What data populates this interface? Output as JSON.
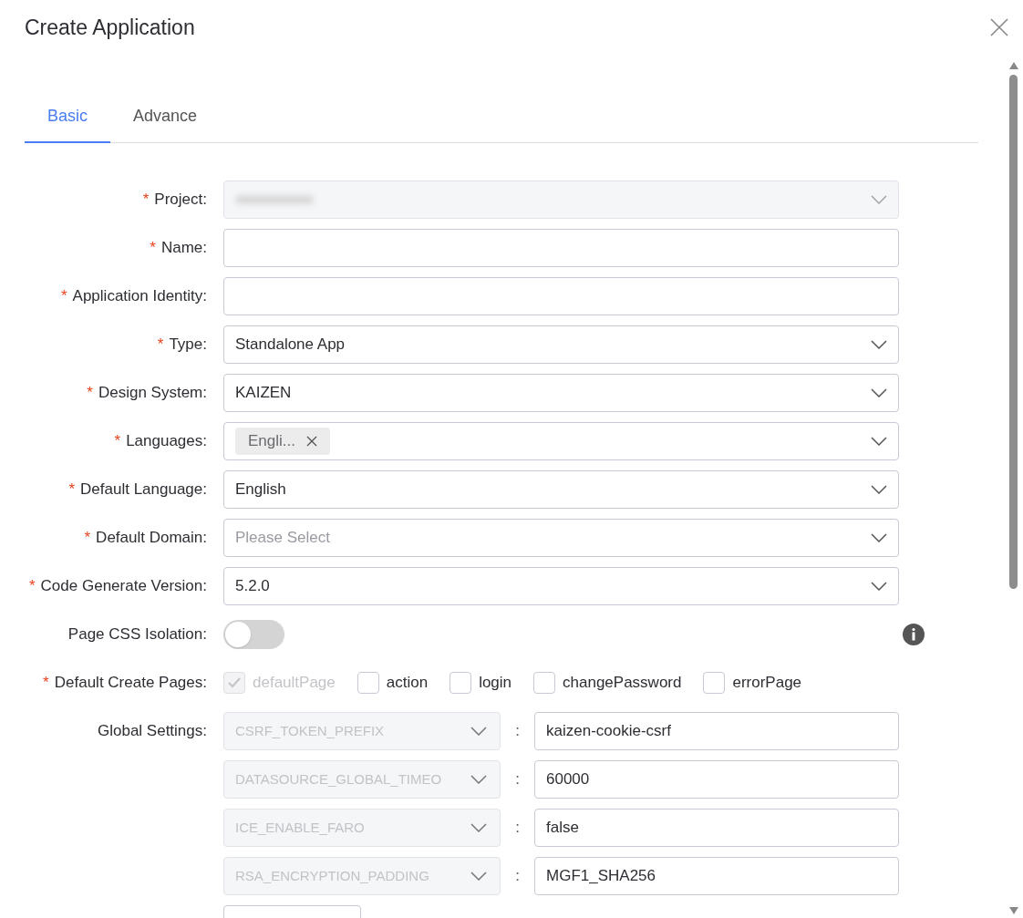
{
  "dialog": {
    "title": "Create Application"
  },
  "tabs": [
    {
      "label": "Basic",
      "selected": true
    },
    {
      "label": "Advance",
      "selected": false
    }
  ],
  "fields": [
    {
      "kind": "select",
      "label": "Project:",
      "required_mark": "*",
      "disabled": true,
      "value_blurred": true
    },
    {
      "kind": "input",
      "label": "Name:",
      "required_mark": "*"
    },
    {
      "kind": "input",
      "label": "Application Identity:",
      "required_mark": "*"
    },
    {
      "kind": "select",
      "label": "Type:",
      "required_mark": "*",
      "disabled": false,
      "value": "Standalone App"
    },
    {
      "kind": "select",
      "label": "Design System:",
      "required_mark": "*",
      "disabled": false,
      "value": "KAIZEN"
    },
    {
      "kind": "tags",
      "label": "Languages:",
      "required_mark": "*",
      "tags": [
        "Engli..."
      ]
    },
    {
      "kind": "select",
      "label": "Default Language:",
      "required_mark": "*",
      "disabled": false,
      "value": "English"
    },
    {
      "kind": "select",
      "label": "Default Domain:",
      "required_mark": "*",
      "disabled": false,
      "placeholder": "Please Select"
    },
    {
      "kind": "select",
      "label": "Code Generate Version:",
      "required_mark": "*",
      "disabled": false,
      "value": "5.2.0"
    },
    {
      "kind": "switch",
      "label": "Page CSS Isolation:",
      "on": false
    },
    {
      "kind": "checkboxes",
      "label": "Default Create Pages:",
      "required_mark": "*",
      "options": [
        {
          "label": "defaultPage",
          "checked": true,
          "disabled": true
        },
        {
          "label": "action",
          "checked": false,
          "disabled": false
        },
        {
          "label": "login",
          "checked": false,
          "disabled": false
        },
        {
          "label": "changePassword",
          "checked": false,
          "disabled": false
        },
        {
          "label": "errorPage",
          "checked": false,
          "disabled": false
        }
      ]
    },
    {
      "kind": "settings",
      "label": "Global Settings:",
      "separator": ":",
      "rows": [
        {
          "key": "CSRF_TOKEN_PREFIX",
          "value": "kaizen-cookie-csrf"
        },
        {
          "key": "DATASOURCE_GLOBAL_TIMEO",
          "value": "60000"
        },
        {
          "key": "ICE_ENABLE_FARO",
          "value": "false"
        },
        {
          "key": "RSA_ENCRYPTION_PADDING",
          "value": "MGF1_SHA256"
        }
      ]
    }
  ]
}
